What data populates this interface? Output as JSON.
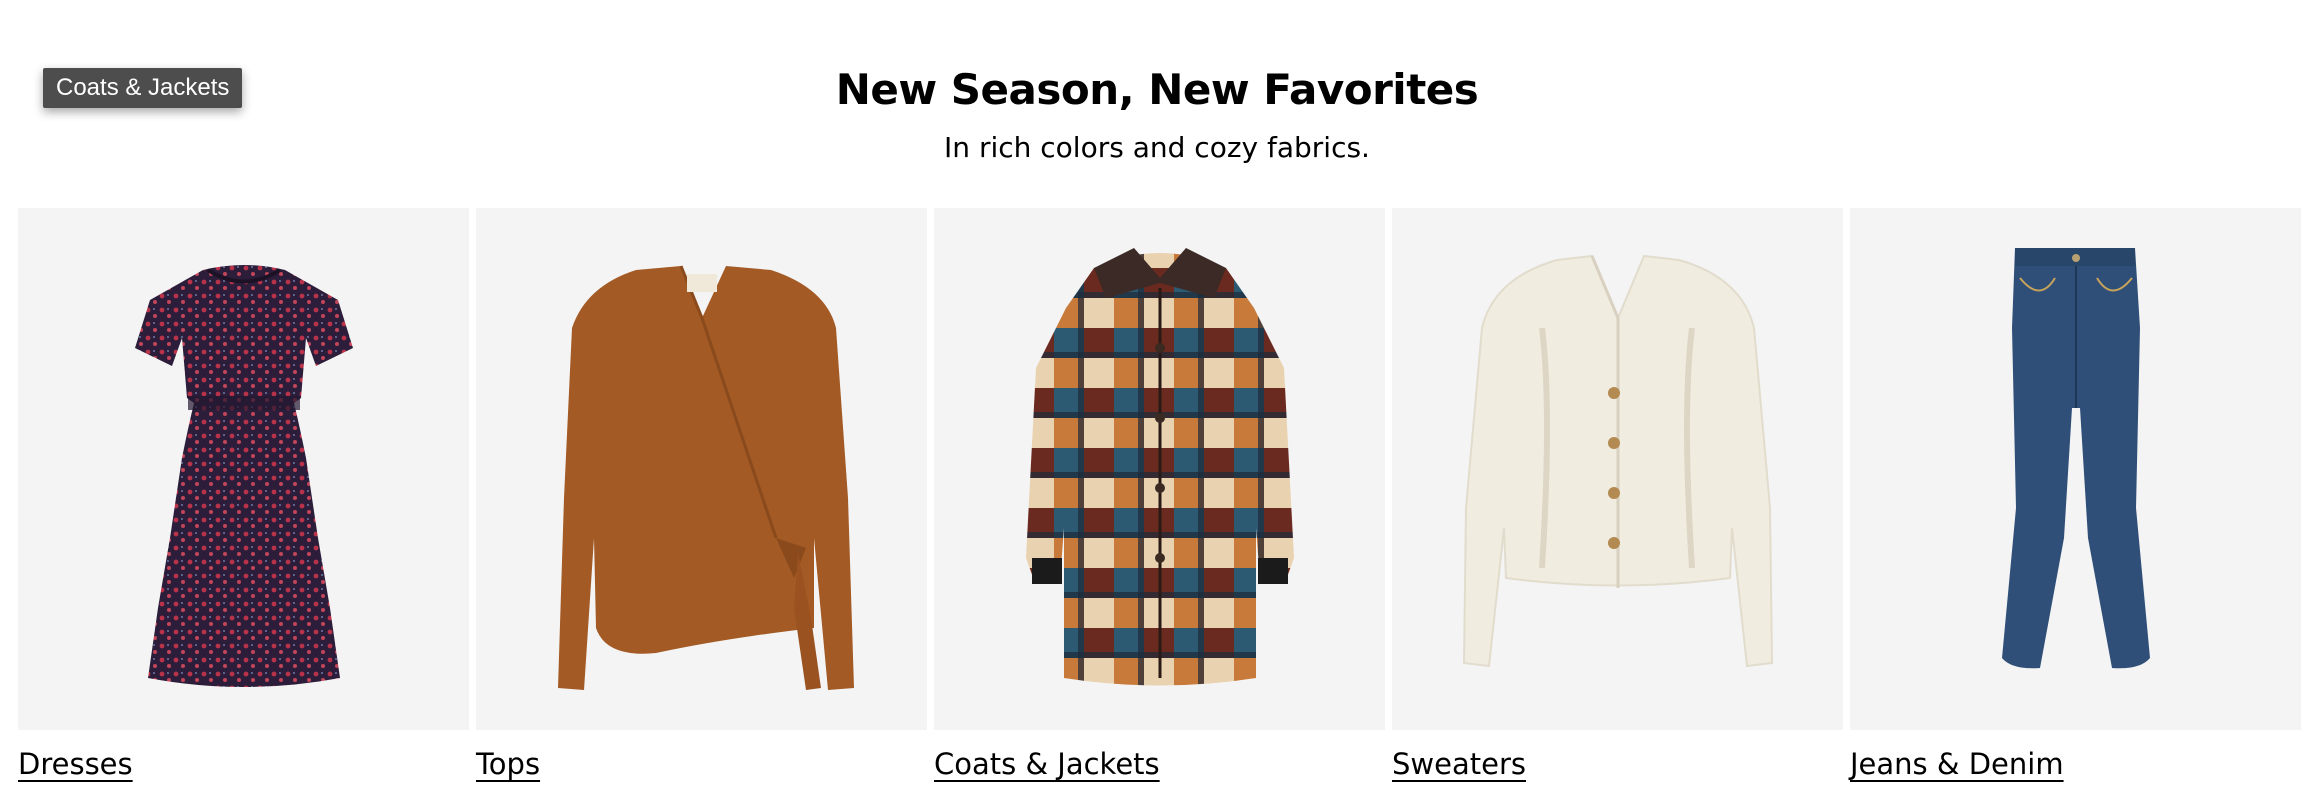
{
  "tooltip": {
    "text": "Coats & Jackets"
  },
  "header": {
    "title": "New Season, New Favorites",
    "subtitle": "In rich colors and cozy fabrics."
  },
  "categories": [
    {
      "label": "Dresses",
      "icon": "dress-image"
    },
    {
      "label": "Tops",
      "icon": "wrap-top-image"
    },
    {
      "label": "Coats & Jackets",
      "icon": "plaid-coat-image"
    },
    {
      "label": "Sweaters",
      "icon": "cardigan-image"
    },
    {
      "label": "Jeans & Denim",
      "icon": "flare-jeans-image"
    }
  ],
  "colors": {
    "tile_background": "#f4f4f4",
    "tooltip_background": "#4d4d4d",
    "dress": "#3a2540",
    "top": "#a35a24",
    "sweater": "#f2ede2",
    "denim": "#2f4f78"
  }
}
